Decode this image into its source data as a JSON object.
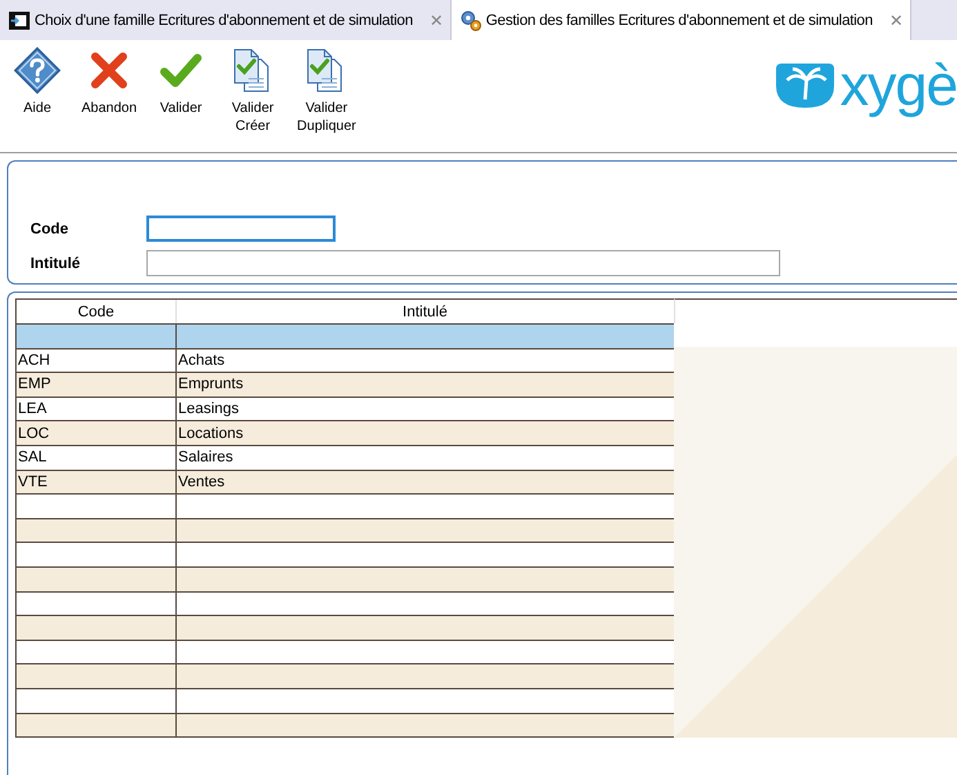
{
  "tabs": [
    {
      "kind": "list",
      "title": "Choix d'une famille Ecritures d'abonnement et de simulation",
      "close": "✕",
      "selected": false
    },
    {
      "kind": "settings",
      "title": "Gestion des familles Ecritures d'abonnement et de simulation",
      "close": "✕",
      "selected": true
    }
  ],
  "toolbar": [
    {
      "kind": "help",
      "label": "Aide"
    },
    {
      "kind": "cancel",
      "label": "Abandon"
    },
    {
      "kind": "ok",
      "label": "Valider"
    },
    {
      "kind": "ok-docs",
      "label": "Valider Créer"
    },
    {
      "kind": "ok-docs",
      "label": "Valider Dupliquer"
    }
  ],
  "logo": {
    "text": "xygè"
  },
  "form": {
    "fields": [
      {
        "label": "Code",
        "focused": true,
        "kind": "short"
      },
      {
        "label": "Intitulé",
        "focused": false,
        "kind": "long"
      }
    ]
  },
  "table": {
    "columns": [
      "Code",
      "Intitulé"
    ],
    "rows": [
      [
        "ACH",
        "Achats"
      ],
      [
        "EMP",
        "Emprunts"
      ],
      [
        "LEA",
        "Leasings"
      ],
      [
        "LOC",
        "Locations"
      ],
      [
        "SAL",
        "Salaires"
      ],
      [
        "VTE",
        "Ventes"
      ]
    ]
  }
}
